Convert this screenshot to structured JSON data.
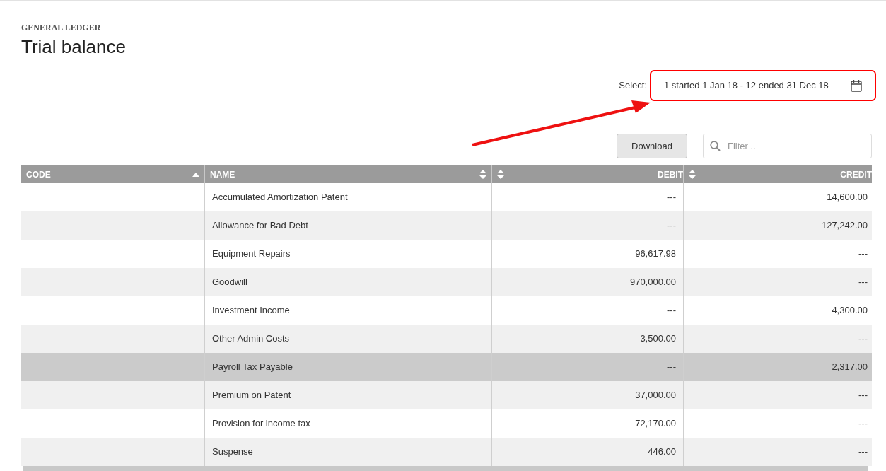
{
  "header": {
    "section": "GENERAL LEDGER",
    "title": "Trial balance"
  },
  "period": {
    "label": "Select:",
    "value": "1 started 1 Jan 18 - 12 ended 31 Dec 18",
    "highlighted": true
  },
  "toolbar": {
    "download": "Download",
    "filter_placeholder": "Filter .."
  },
  "table": {
    "columns": [
      {
        "label": "CODE",
        "kind": "text",
        "sorted_ascending": true
      },
      {
        "label": "NAME",
        "kind": "text",
        "sorted_ascending": false
      },
      {
        "label": "DEBIT",
        "kind": "amount",
        "sorted_ascending": false
      },
      {
        "label": "CREDIT",
        "kind": "amount",
        "sorted_ascending": false
      }
    ],
    "rows": [
      {
        "name": "Accumulated Amortization Patent",
        "debit": "---",
        "credit": "14,600.00",
        "selected": false
      },
      {
        "name": "Allowance for Bad Debt",
        "debit": "---",
        "credit": "127,242.00",
        "selected": false
      },
      {
        "name": "Equipment Repairs",
        "debit": "96,617.98",
        "credit": "---",
        "selected": false
      },
      {
        "name": "Goodwill",
        "debit": "970,000.00",
        "credit": "---",
        "selected": false
      },
      {
        "name": "Investment Income",
        "debit": "---",
        "credit": "4,300.00",
        "selected": false
      },
      {
        "name": "Other Admin Costs",
        "debit": "3,500.00",
        "credit": "---",
        "selected": false
      },
      {
        "name": "Payroll Tax Payable",
        "debit": "---",
        "credit": "2,317.00",
        "selected": true
      },
      {
        "name": "Premium on Patent",
        "debit": "37,000.00",
        "credit": "---",
        "selected": false
      },
      {
        "name": "Provision for income tax",
        "debit": "72,170.00",
        "credit": "---",
        "selected": false
      },
      {
        "name": "Suspense",
        "debit": "446.00",
        "credit": "---",
        "selected": false
      }
    ]
  }
}
